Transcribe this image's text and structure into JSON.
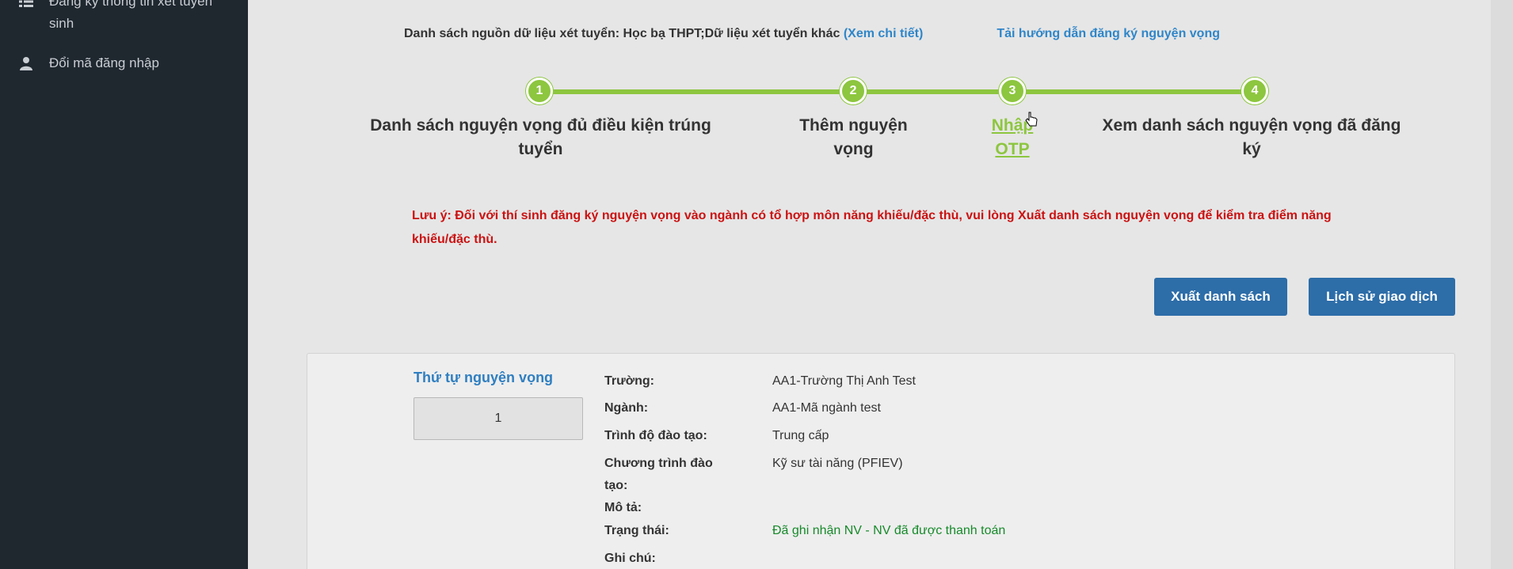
{
  "sidebar": {
    "items": [
      {
        "icon": "list-icon",
        "label": "Đăng ký thông tin xét tuyển sinh"
      },
      {
        "icon": "user-icon",
        "label": "Đổi mã đăng nhập"
      }
    ]
  },
  "header": {
    "source_prefix": "Danh sách nguồn dữ liệu xét tuyển: Học bạ THPT;Dữ liệu xét tuyển khác",
    "source_link": "(Xem chi tiết)",
    "guide_link": "Tải hướng dẫn đăng ký nguyện vọng"
  },
  "stepper": {
    "steps": [
      {
        "number": "1",
        "label": "Danh sách nguyện vọng đủ điều kiện trúng tuyển"
      },
      {
        "number": "2",
        "label": "Thêm nguyện vọng"
      },
      {
        "number": "3",
        "label": "Nhập OTP"
      },
      {
        "number": "4",
        "label": "Xem danh sách nguyện vọng đã đăng ký"
      }
    ],
    "active_step": 3,
    "accent": "#8dc63f"
  },
  "note": "Lưu ý: Đối với thí sinh đăng ký nguyện vọng vào ngành có tổ hợp môn năng khiếu/đặc thù, vui lòng Xuất danh sách nguyện vọng để kiểm tra điểm năng khiếu/đặc thù.",
  "buttons": {
    "export": "Xuất danh sách",
    "history": "Lịch sử giao dịch"
  },
  "card": {
    "order_title": "Thứ tự nguyện vọng",
    "order_value": "1",
    "fields": [
      {
        "label": "Trường:",
        "value": "AA1-Trường Thị Anh Test"
      },
      {
        "label": "Ngành:",
        "value": "AA1-Mã ngành test"
      },
      {
        "label": "Trình độ đào tạo:",
        "value": "Trung cấp"
      },
      {
        "label": "Chương trình đào tạo:",
        "value": "Kỹ sư tài năng (PFIEV)"
      },
      {
        "label": "Mô tả:",
        "value": ""
      },
      {
        "label": "Trạng thái:",
        "value": "Đã ghi nhận NV - NV đã được thanh toán"
      },
      {
        "label": "Ghi chú:",
        "value": ""
      }
    ]
  }
}
